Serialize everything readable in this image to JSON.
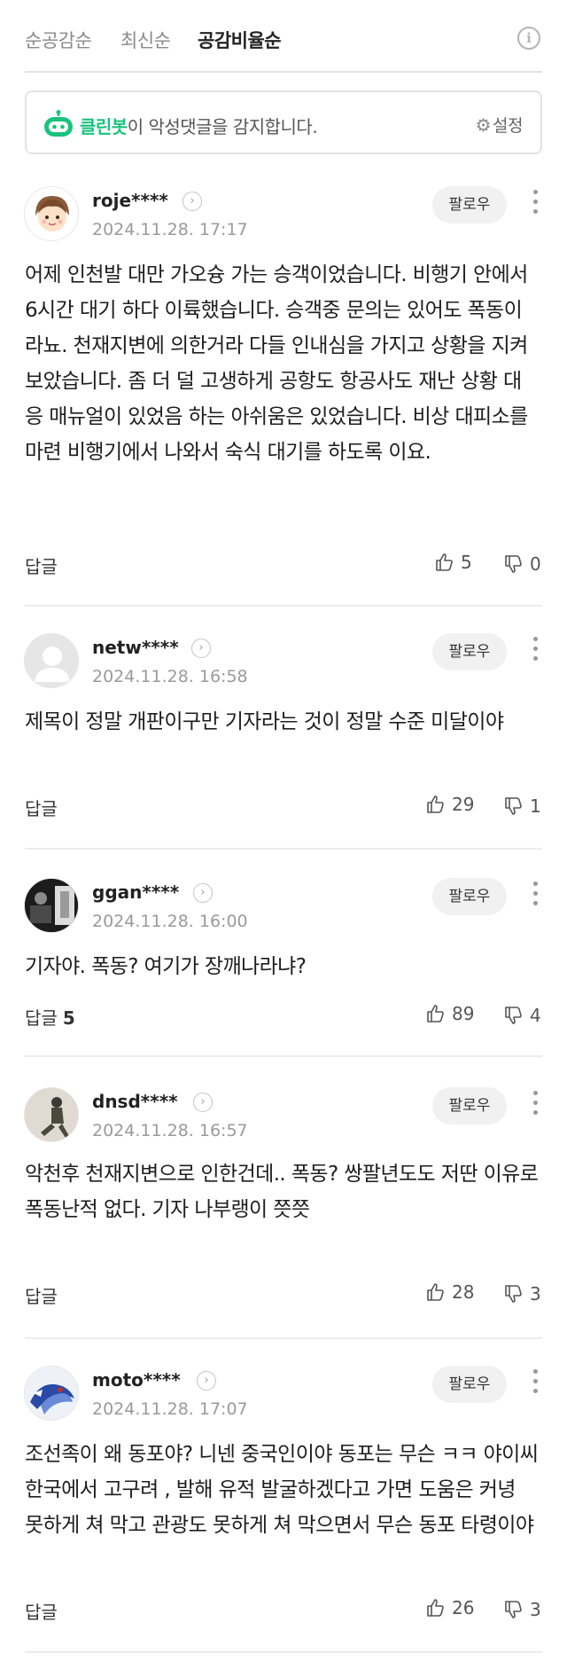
{
  "sort": {
    "tabs": [
      {
        "label": "순공감순"
      },
      {
        "label": "최신순"
      },
      {
        "label": "공감비율순"
      }
    ],
    "active_index": 2,
    "info_icon": "i"
  },
  "cleanbot": {
    "brand": "클린봇",
    "message": "이 악성댓글을 감지합니다.",
    "settings_label": "설정"
  },
  "follow_label": "팔로우",
  "reply_label": "답글",
  "comments": [
    {
      "author": "roje****",
      "date": "2024.11.28. 17:17",
      "text": "어제 인천발 대만 가오슝 가는 승객이었습니다. 비행기 안에서 6시간 대기 하다 이륙했습니다. 승객중 문의는 있어도 폭동이라뇨. 천재지변에 의한거라 다들 인내심을 가지고 상황을 지켜 보았습니다. 좀 더 덜 고생하게 공항도 항공사도 재난 상황 대응 매뉴얼이 있었음 하는 아쉬움은 있었습니다. 비상 대피소를 마련 비행기에서 나와서 숙식 대기를 하도록 이요.",
      "reply_count": "",
      "likes": "5",
      "dislikes": "0"
    },
    {
      "author": "netw****",
      "date": "2024.11.28. 16:58",
      "text": "제목이 정말 개판이구만 기자라는 것이 정말 수준 미달이야",
      "reply_count": "",
      "likes": "29",
      "dislikes": "1"
    },
    {
      "author": "ggan****",
      "date": "2024.11.28. 16:00",
      "text": "기자야. 폭동? 여기가 장깨나라냐?",
      "reply_count": "5",
      "likes": "89",
      "dislikes": "4"
    },
    {
      "author": "dnsd****",
      "date": "2024.11.28. 16:57",
      "text": "악천후 천재지변으로 인한건데.. 폭동? 쌍팔년도도 저딴 이유로 폭동난적 없다. 기자 나부랭이 쯧쯧",
      "reply_count": "",
      "likes": "28",
      "dislikes": "3"
    },
    {
      "author": "moto****",
      "date": "2024.11.28. 17:07",
      "text": "조선족이 왜 동포야? 니넨 중국인이야 동포는 무슨 ㅋㅋ 야이씨 한국에서 고구려 , 발해 유적 발굴하겠다고 가면 도움은 커녕 못하게 쳐 막고 관광도 못하게 쳐 막으면서 무슨 동포 타령이야",
      "reply_count": "",
      "likes": "26",
      "dislikes": "3"
    }
  ],
  "colors": {
    "brand_green": "#19c37d",
    "date_gray": "#9a9a9a",
    "follow_bg": "#f1f1f1"
  }
}
